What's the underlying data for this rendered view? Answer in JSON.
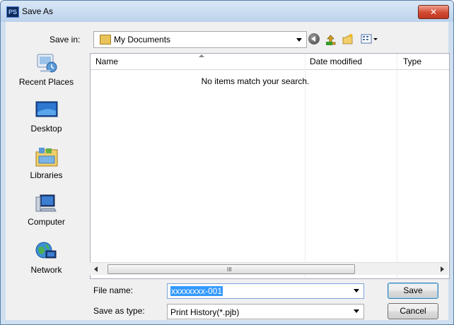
{
  "window": {
    "title": "Save As",
    "app_icon": "PS",
    "close_glyph": "✕"
  },
  "toolbar": {
    "save_in_label": "Save in:",
    "save_in_value": "My Documents",
    "icons": [
      "back-icon",
      "up-folder-icon",
      "new-folder-icon",
      "views-menu-icon"
    ]
  },
  "places": [
    {
      "label": "Recent Places",
      "icon": "recent-places-icon"
    },
    {
      "label": "Desktop",
      "icon": "desktop-icon"
    },
    {
      "label": "Libraries",
      "icon": "libraries-icon"
    },
    {
      "label": "Computer",
      "icon": "computer-icon"
    },
    {
      "label": "Network",
      "icon": "network-icon"
    }
  ],
  "file_list": {
    "columns": [
      "Name",
      "Date modified",
      "Type"
    ],
    "empty_message": "No items match your search.",
    "scroll_grip": "III"
  },
  "form": {
    "file_name_label": "File name:",
    "file_name_value": "xxxxxxxx-001",
    "save_as_type_label": "Save as type:",
    "save_as_type_value": "Print History(*.pjb)"
  },
  "buttons": {
    "save": "Save",
    "cancel": "Cancel"
  },
  "colors": {
    "selection": "#3399ff",
    "title_bar": "#bcd2ec",
    "close": "#d04a30"
  }
}
